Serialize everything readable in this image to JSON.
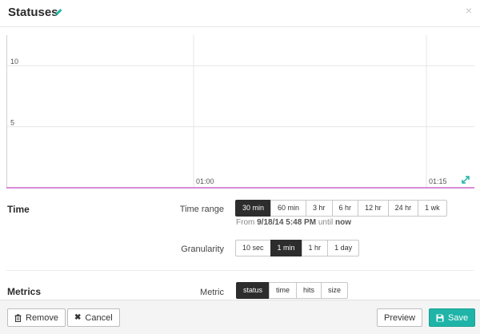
{
  "header": {
    "title": "Statuses",
    "edit_icon": "pencil-icon",
    "close_label": "×"
  },
  "chart_data": {
    "type": "line",
    "title": "",
    "xlabel": "",
    "ylabel": "",
    "x_ticks": [
      "01:00",
      "01:15"
    ],
    "y_ticks": [
      5,
      10
    ],
    "ylim": [
      0,
      12.5
    ],
    "grid": true,
    "series": [],
    "accent_color": "#cc66cc"
  },
  "time": {
    "section_label": "Time",
    "range_label": "Time range",
    "range_options": [
      "30 min",
      "60 min",
      "3 hr",
      "6 hr",
      "12 hr",
      "24 hr",
      "1 wk"
    ],
    "range_selected": "30 min",
    "from_prefix": "From",
    "from_value": "9/18/14 5:48 PM",
    "until_word": "until",
    "until_value": "now",
    "granularity_label": "Granularity",
    "granularity_options": [
      "10 sec",
      "1 min",
      "1 hr",
      "1 day"
    ],
    "granularity_selected": "1 min"
  },
  "metrics": {
    "section_label": "Metrics",
    "metric_label": "Metric",
    "metric_options": [
      "status",
      "time",
      "hits",
      "size"
    ],
    "metric_selected": "status"
  },
  "footer": {
    "remove_label": "Remove",
    "cancel_label": "Cancel",
    "preview_label": "Preview",
    "save_label": "Save",
    "save_color": "#1fb4a7"
  }
}
